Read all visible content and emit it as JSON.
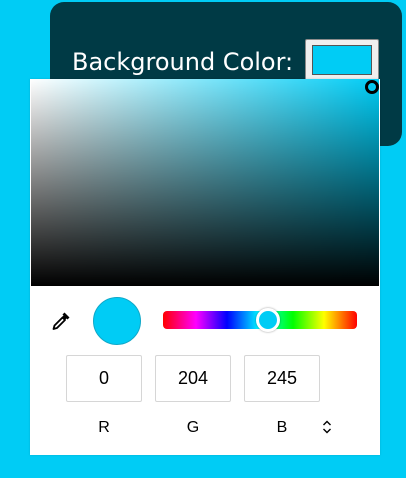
{
  "panel": {
    "label": "Background Color:",
    "color_value": "#00ccf5"
  },
  "picker": {
    "hue_color": "#00ccf5",
    "hue_position": 0.54,
    "preview_color": "#00ccf5",
    "inputs": [
      {
        "value": "0",
        "label": "R"
      },
      {
        "value": "204",
        "label": "G"
      },
      {
        "value": "245",
        "label": "B"
      }
    ],
    "icons": {
      "eyedropper": "eyedropper-icon",
      "mode_toggle": "chevron-up-down-icon"
    }
  }
}
